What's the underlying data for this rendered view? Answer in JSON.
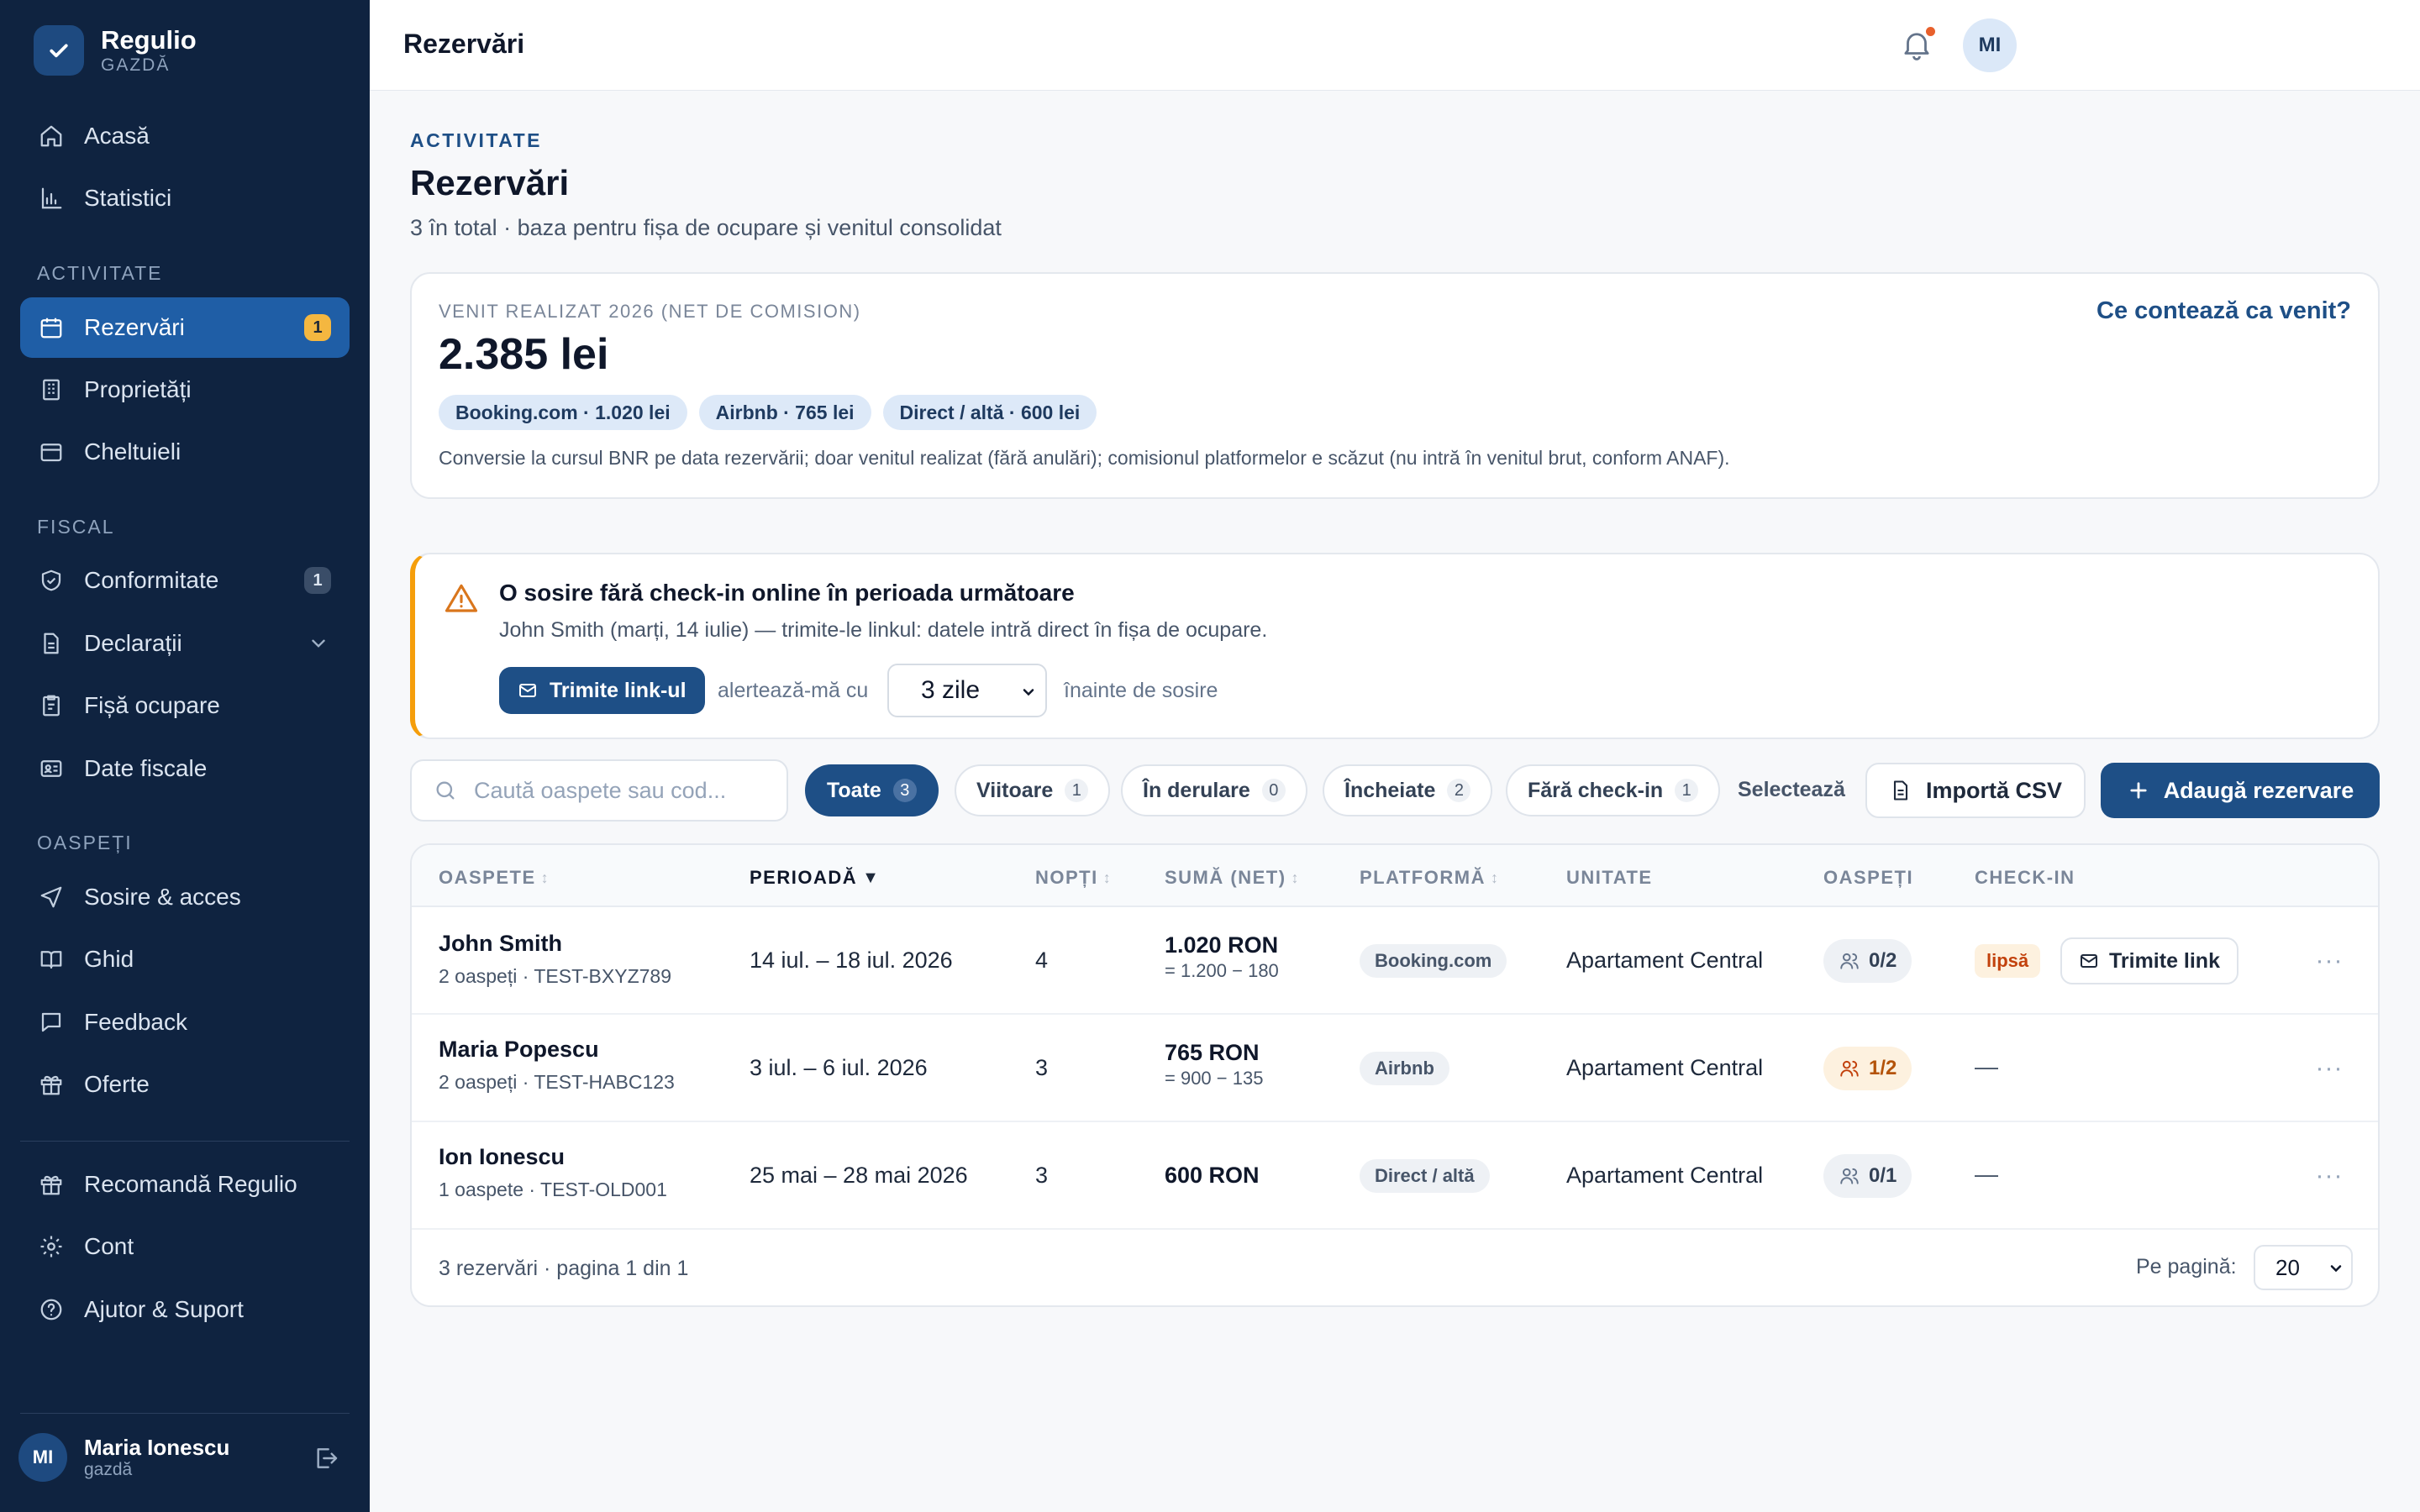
{
  "brand": {
    "name": "Regulio",
    "sub": "GAZDĂ"
  },
  "nav": {
    "top": [
      {
        "label": "Acasă",
        "icon": "home-icon"
      },
      {
        "label": "Statistici",
        "icon": "bar-chart-icon"
      }
    ],
    "section_activitate": "ACTIVITATE",
    "activitate": [
      {
        "label": "Rezervări",
        "icon": "calendar-icon",
        "badge": "1",
        "active": true
      },
      {
        "label": "Proprietăți",
        "icon": "building-icon"
      },
      {
        "label": "Cheltuieli",
        "icon": "wallet-icon"
      }
    ],
    "section_fiscal": "FISCAL",
    "fiscal": [
      {
        "label": "Conformitate",
        "icon": "shield-check-icon",
        "badge": "1"
      },
      {
        "label": "Declarații",
        "icon": "document-icon"
      },
      {
        "label": "Fișă ocupare",
        "icon": "clipboard-icon"
      },
      {
        "label": "Date fiscale",
        "icon": "id-card-icon"
      }
    ],
    "section_oaspeti": "OASPEȚI",
    "oaspeti": [
      {
        "label": "Sosire & acces",
        "icon": "send-icon"
      },
      {
        "label": "Ghid",
        "icon": "book-icon"
      },
      {
        "label": "Feedback",
        "icon": "message-icon"
      },
      {
        "label": "Oferte",
        "icon": "gift-icon"
      }
    ],
    "bottom": [
      {
        "label": "Recomandă Regulio",
        "icon": "gift-icon"
      },
      {
        "label": "Cont",
        "icon": "gear-icon"
      },
      {
        "label": "Ajutor & Suport",
        "icon": "help-icon"
      }
    ]
  },
  "user": {
    "initials": "MI",
    "name": "Maria Ionescu",
    "role": "gazdă"
  },
  "topbar": {
    "title": "Rezervări",
    "avatar": "MI"
  },
  "header": {
    "eyebrow": "ACTIVITATE",
    "title": "Rezervări",
    "subtitle": "3 în total · baza pentru fișa de ocupare și venitul consolidat"
  },
  "revenue": {
    "label": "VENIT REALIZAT 2026 (NET DE COMISION)",
    "value": "2.385 lei",
    "link": "Ce contează ca venit?",
    "chips": [
      "Booking.com · 1.020 lei",
      "Airbnb · 765 lei",
      "Direct / altă · 600 lei"
    ],
    "note": "Conversie la cursul BNR pe data rezervării; doar venitul realizat (fără anulări); comisionul platformelor e scăzut (nu intră în venitul brut, conform ANAF)."
  },
  "alert": {
    "title": "O sosire fără check-in online în perioada următoare",
    "text": "John Smith (marți, 14 iulie) — trimite-le linkul: datele intră direct în fișa de ocupare.",
    "button": "Trimite link-ul",
    "label_before": "alertează-mă cu",
    "select_value": "3 zile",
    "label_after": "înainte de sosire"
  },
  "filters": {
    "search_placeholder": "Caută oaspete sau cod...",
    "pills": [
      {
        "label": "Toate",
        "count": "3",
        "active": true
      },
      {
        "label": "Viitoare",
        "count": "1"
      },
      {
        "label": "În derulare",
        "count": "0"
      },
      {
        "label": "Încheiate",
        "count": "2"
      },
      {
        "label": "Fără check-in",
        "count": "1"
      }
    ],
    "select_label": "Selectează",
    "import_label": "Importă CSV",
    "add_label": "Adaugă rezervare"
  },
  "table": {
    "headers": {
      "guest": "OASPETE",
      "period": "PERIOADĂ",
      "nights": "NOPȚI",
      "amount": "SUMĂ (NET)",
      "platform": "PLATFORMĂ",
      "unit": "UNITATE",
      "guests": "OASPEȚI",
      "checkin": "CHECK-IN"
    },
    "rows": [
      {
        "name": "John Smith",
        "sub": "2 oaspeți · TEST-BXYZ789",
        "period": "14 iul. – 18 iul. 2026",
        "nights": "4",
        "amount": "1.020 RON",
        "amount_sub": "= 1.200 − 180",
        "platform": "Booking.com",
        "unit": "Apartament Central",
        "guests": "0/2",
        "guests_warn": false,
        "checkin_badge": "lipsă",
        "checkin_button": "Trimite link"
      },
      {
        "name": "Maria Popescu",
        "sub": "2 oaspeți · TEST-HABC123",
        "period": "3 iul. – 6 iul. 2026",
        "nights": "3",
        "amount": "765 RON",
        "amount_sub": "= 900 − 135",
        "platform": "Airbnb",
        "unit": "Apartament Central",
        "guests": "1/2",
        "guests_warn": true,
        "checkin": "—"
      },
      {
        "name": "Ion Ionescu",
        "sub": "1 oaspete · TEST-OLD001",
        "period": "25 mai – 28 mai 2026",
        "nights": "3",
        "amount": "600 RON",
        "amount_sub": "",
        "platform": "Direct / altă",
        "unit": "Apartament Central",
        "guests": "0/1",
        "guests_warn": false,
        "checkin": "—"
      }
    ],
    "footer": "3 rezervări · pagina 1 din 1",
    "per_page_label": "Pe pagină:",
    "per_page": "20"
  }
}
